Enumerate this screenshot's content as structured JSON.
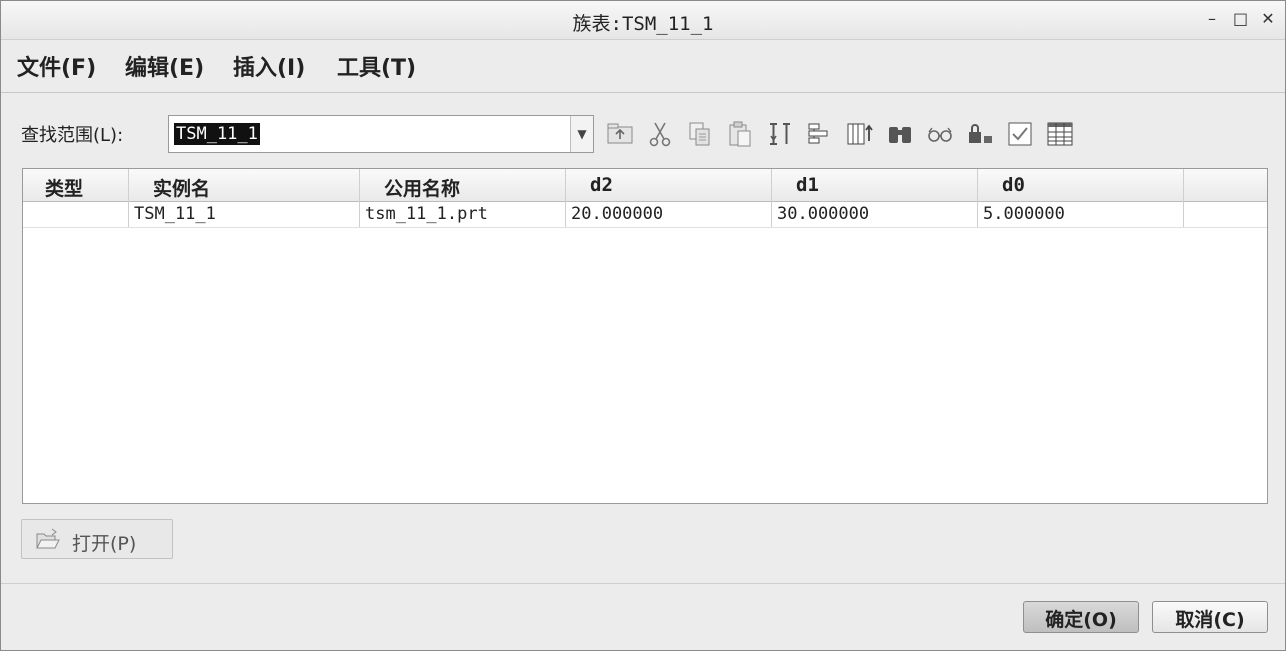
{
  "window": {
    "title": "族表:TSM_11_1",
    "controls": {
      "minimize": "–",
      "maximize": "□",
      "close": "✕"
    }
  },
  "menu": {
    "file": "文件(F)",
    "edit": "编辑(E)",
    "insert": "插入(I)",
    "tools": "工具(T)"
  },
  "search": {
    "label": "查找范围(L):",
    "value": "TSM_11_1"
  },
  "toolbar_icons": [
    "up-level-icon",
    "cut-icon",
    "copy-icon",
    "paste-icon",
    "insert-column-icon",
    "insert-instance-icon",
    "add-column-icon",
    "find-icon",
    "preview-icon",
    "lock-icon",
    "verify-icon",
    "table-icon"
  ],
  "table": {
    "headers": [
      "类型",
      "实例名",
      "公用名称",
      "d2",
      "d1",
      "d0"
    ],
    "rows": [
      [
        "",
        "TSM_11_1",
        "tsm_11_1.prt",
        "20.000000",
        "30.000000",
        "5.000000"
      ]
    ]
  },
  "buttons": {
    "open": "打开(P)",
    "ok": "确定(O)",
    "cancel": "取消(C)"
  }
}
